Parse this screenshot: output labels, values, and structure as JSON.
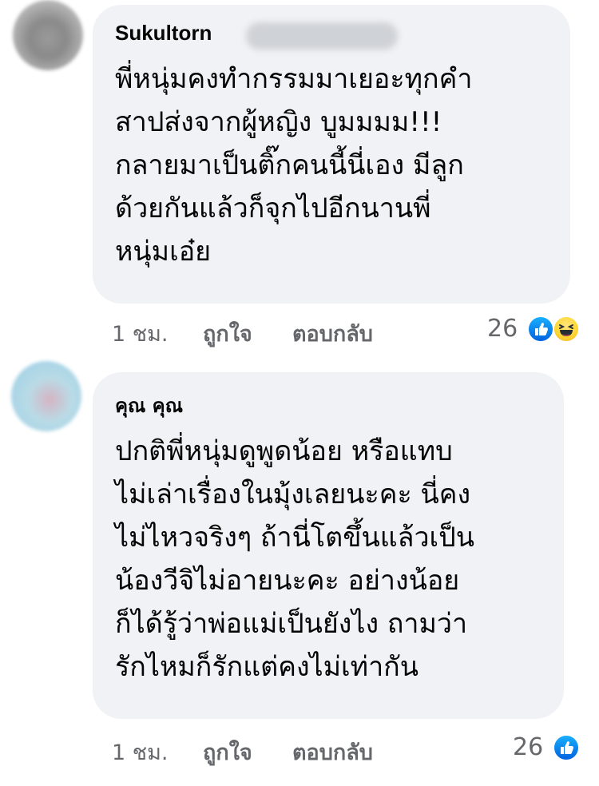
{
  "comments": [
    {
      "author": "Sukultorn",
      "lines": [
        "พี่หนุ่มคงทำกรรมมาเยอะทุกคำ",
        "สาปส่งจากผู้หญิง บูมมมม!!!",
        "กลายมาเป็นติ๊กคนนี้นี่เอง มีลูก",
        "ด้วยกันแล้วก็จุกไปอีกนานพี่",
        "หนุ่มเอ๋ย"
      ],
      "time": "1 ชม.",
      "like_label": "ถูกใจ",
      "reply_label": "ตอบกลับ",
      "reaction_count": "26",
      "reactions": [
        "like-icon",
        "haha-icon"
      ]
    },
    {
      "author": "คุณ คุณ",
      "lines": [
        "ปกติพี่หนุ่มดูพูดน้อย หรือแทบ",
        "ไม่เล่าเรื่องในมุ้งเลยนะคะ นี่คง",
        "ไม่ไหวจริงๆ ถ้านี่โตขึ้นแล้วเป็น",
        "น้องวีจิไม่อายนะคะ อย่างน้อย",
        "ก็ได้รู้ว่าพ่อแม่เป็นยังไง ถามว่า",
        "รักไหมก็รักแต่คงไม่เท่ากัน"
      ],
      "time": "1 ชม.",
      "like_label": "ถูกใจ",
      "reply_label": "ตอบกลับ",
      "reaction_count": "26",
      "reactions": [
        "like-icon"
      ]
    }
  ],
  "colors": {
    "bubble": "#f0f2f5",
    "meta_text": "#65676b",
    "like_blue": "#0b7cff",
    "haha_yellow": "#fdd835"
  }
}
